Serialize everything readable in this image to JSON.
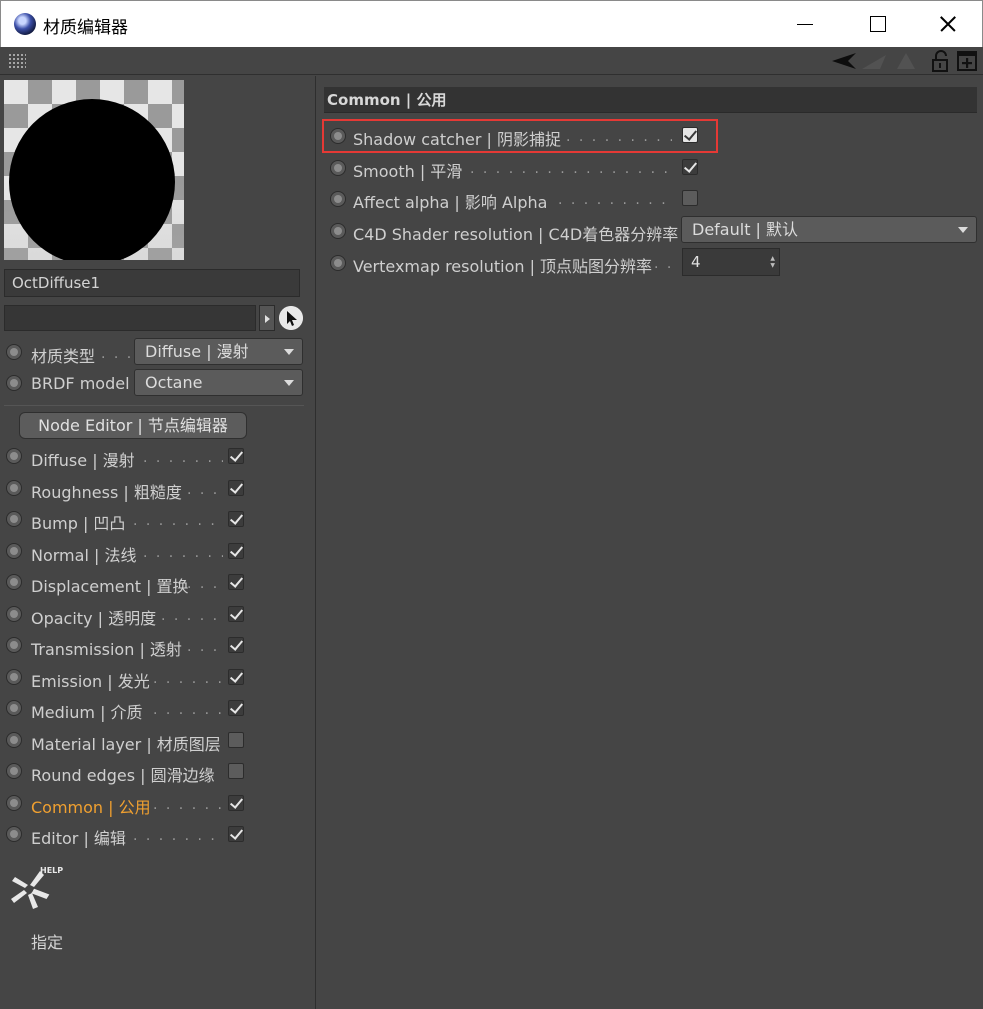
{
  "window": {
    "title": "材质编辑器"
  },
  "material": {
    "name": "OctDiffuse1",
    "link_value": ""
  },
  "params": [
    {
      "label": "材质类型",
      "value": "Diffuse | 漫射"
    },
    {
      "label": "BRDF model",
      "value": "Octane"
    }
  ],
  "node_editor_label": "Node Editor | 节点编辑器",
  "channels": [
    {
      "label": "Diffuse | 漫射",
      "checked": true
    },
    {
      "label": "Roughness | 粗糙度",
      "checked": true
    },
    {
      "label": "Bump | 凹凸",
      "checked": true
    },
    {
      "label": "Normal | 法线",
      "checked": true
    },
    {
      "label": "Displacement | 置换",
      "checked": true
    },
    {
      "label": "Opacity | 透明度",
      "checked": true
    },
    {
      "label": "Transmission | 透射",
      "checked": true
    },
    {
      "label": "Emission | 发光",
      "checked": true
    },
    {
      "label": "Medium | 介质",
      "checked": true
    },
    {
      "label": "Material layer | 材质图层",
      "checked": false
    },
    {
      "label": "Round edges | 圆滑边缘",
      "checked": false
    },
    {
      "label": "Common | 公用",
      "checked": true,
      "active": true
    },
    {
      "label": "Editor | 编辑",
      "checked": true
    }
  ],
  "help": {
    "icon_text": "HELP",
    "assign_label": "指定"
  },
  "common": {
    "header": "Common | 公用",
    "shadow_catcher": {
      "label": "Shadow catcher | 阴影捕捉",
      "checked": true
    },
    "smooth": {
      "label": "Smooth | 平滑",
      "checked": true
    },
    "affect_alpha": {
      "label": "Affect alpha | 影响 Alpha",
      "checked": false
    },
    "c4d_shader_res": {
      "label": "C4D Shader resolution | C4D着色器分辨率",
      "value": "Default | 默认"
    },
    "vertexmap_res": {
      "label": "Vertexmap resolution | 顶点贴图分辨率",
      "value": "4"
    }
  },
  "colors": {
    "accent": "#f0a030",
    "highlight_box": "#e53935",
    "panel_bg": "#454545"
  }
}
